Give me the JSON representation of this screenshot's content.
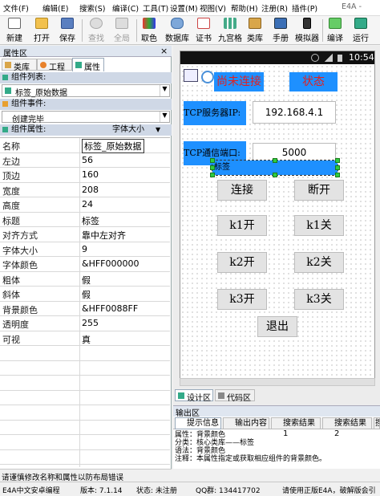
{
  "menu": [
    "文件(F)",
    "编辑(E)",
    "搜索(S)",
    "编译(C)",
    "工具(T)",
    "设置(M)",
    "视图(V)",
    "帮助(H)",
    "注册(R)",
    "插件(P)"
  ],
  "window_title": "E4A -",
  "toolbar": [
    "新建",
    "打开",
    "保存",
    "查找",
    "全局",
    "取色",
    "数据库",
    "证书",
    "九宫格",
    "类库",
    "手册",
    "模拟器",
    "编译",
    "运行"
  ],
  "left": {
    "title": "属性区",
    "tabs": [
      "类库",
      "工程",
      "属性"
    ],
    "component_list_label": "组件列表:",
    "component_list_value": "标签_原始数据",
    "component_event_label": "组件事件:",
    "component_event_value": "创建完毕",
    "component_attr_label": "组件属性:",
    "component_attr_value": "字体大小",
    "props": [
      {
        "k": "名称",
        "v": "标签_原始数据"
      },
      {
        "k": "左边",
        "v": "56"
      },
      {
        "k": "顶边",
        "v": "160"
      },
      {
        "k": "宽度",
        "v": "208"
      },
      {
        "k": "高度",
        "v": "24"
      },
      {
        "k": "标题",
        "v": "标签"
      },
      {
        "k": "对齐方式",
        "v": "靠中左对齐"
      },
      {
        "k": "字体大小",
        "v": "9"
      },
      {
        "k": "字体颜色",
        "v": "&HFF000000"
      },
      {
        "k": "粗体",
        "v": "假"
      },
      {
        "k": "斜体",
        "v": "假"
      },
      {
        "k": "背景颜色",
        "v": "&HFF0088FF"
      },
      {
        "k": "透明度",
        "v": "255"
      },
      {
        "k": "可视",
        "v": "真"
      }
    ],
    "hint": "请谨慎修改名称和属性以防布局错误"
  },
  "phone": {
    "time": "10:54",
    "btn_connect_top": "尚未连接",
    "btn_status": "状态",
    "label_ip": "TCP服务器IP:",
    "ip_value": "192.168.4.1",
    "label_port": "TCP通信端口:",
    "port_value": "5000",
    "selected_label": "标签",
    "buttons": [
      "连接",
      "断开",
      "k1开",
      "k1关",
      "k2开",
      "k2关",
      "k3开",
      "k3关",
      "退出"
    ]
  },
  "right_tabs": [
    "设计区",
    "代码区"
  ],
  "output": {
    "title": "输出区",
    "tabs": [
      "提示信息",
      "输出内容",
      "搜索结果1",
      "搜索结果2",
      "搜索"
    ],
    "lines": [
      "属性：背景颜色",
      "分类：核心类库——标签",
      "语法：背景颜色",
      "注释：本属性指定或获取相应组件的背景颜色。"
    ]
  },
  "status": {
    "app": "E4A中文安卓编程",
    "version": "版本: 7.1.14",
    "state": "状态: 未注册",
    "qq": "QQ群: 134417702",
    "notice": "请使用正版E4A，破解版会引"
  }
}
